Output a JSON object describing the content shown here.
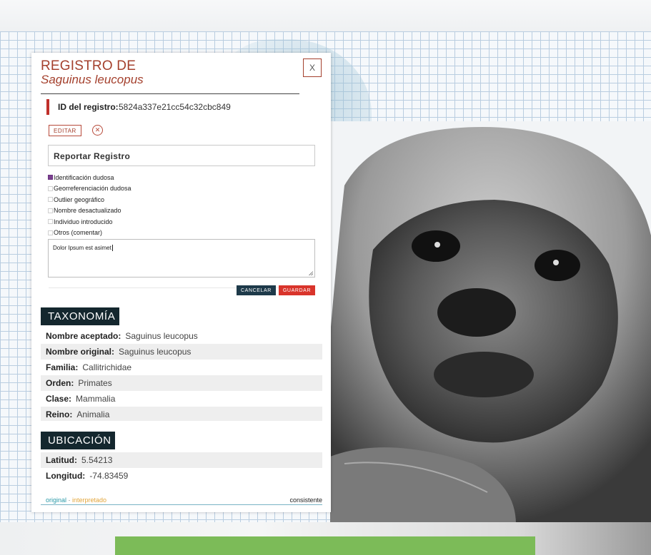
{
  "dialog": {
    "title_line1": "REGISTRO DE",
    "title_line2": "Saguinus leucopus",
    "close_label": "X",
    "id_label": "ID del registro:",
    "id_value": "5824a337e21cc54c32cbc849",
    "edit_label": "EDITAR"
  },
  "report": {
    "title": "Reportar Registro",
    "options": [
      {
        "label": "Identificación dudosa",
        "checked": true
      },
      {
        "label": "Georreferenciación dudosa",
        "checked": false
      },
      {
        "label": "Outlier geográfico",
        "checked": false
      },
      {
        "label": "Nombre desactualizado",
        "checked": false
      },
      {
        "label": "Individuo introducido",
        "checked": false
      },
      {
        "label": "Otros (comentar)",
        "checked": false
      }
    ],
    "comment": "Dolor Ipsum est asimet",
    "cancel_label": "CANCELAR",
    "save_label": "GUARDAR"
  },
  "taxonomy": {
    "heading": "TAXONOMÍA",
    "rows": [
      {
        "label": "Nombre aceptado:",
        "value": "Saguinus leucopus"
      },
      {
        "label": "Nombre original:",
        "value": "Saguinus leucopus"
      },
      {
        "label": "Familia:",
        "value": "Callitrichidae"
      },
      {
        "label": "Orden:",
        "value": "Primates"
      },
      {
        "label": "Clase:",
        "value": "Mammalia"
      },
      {
        "label": "Reino:",
        "value": "Animalia"
      }
    ]
  },
  "location": {
    "heading": "UBICACIÓN",
    "rows": [
      {
        "label": "Latitud:",
        "value": "5.54213"
      },
      {
        "label": "Longitud:",
        "value": "-74.83459"
      }
    ]
  },
  "footer": {
    "original": "original",
    "separator": " · ",
    "interpreted": "interpretado",
    "status": "consistente"
  },
  "colors": {
    "accent": "#a4402d",
    "cancel": "#1e3a4a",
    "save": "#d9342b",
    "section_head": "#14272e",
    "original": "#2b9aa8",
    "interpreted": "#e2a53a"
  }
}
